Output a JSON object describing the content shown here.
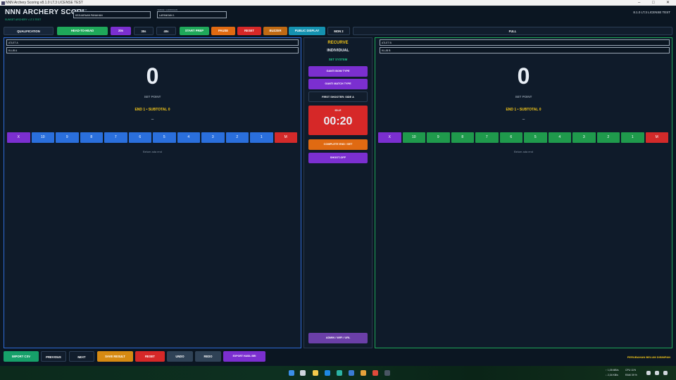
{
  "window": {
    "title": "NNN Archery Scoring v8.1.0 LT.3 LICENSE TEST",
    "minimize": "–",
    "maximize": "□",
    "close": "✕"
  },
  "header": {
    "brand": "NNN ARCHERY SCORI",
    "brand_sub": "SUNSET ARCHERY • LT.3 TEST",
    "event_label": "NAMA EVENT",
    "event_value": "KEJUARAAN PANAHAN",
    "venue_label": "VENUE / LAPANGAN",
    "venue_value": "LAPANGAN 1",
    "version": "8.1.0 LT.3 LICENSE TEST"
  },
  "toolbar": {
    "qualification": "QUALIFICATION",
    "head_to_head": "HEAD-TO-HEAD",
    "t20": "20s",
    "t30": "30s",
    "t40": "40s",
    "start_prep": "START PREP",
    "pause": "PAUSE",
    "reset": "RESET",
    "buzzer": "BUZZER",
    "public_display": "PUBLIC DISPLAY",
    "mon": "MON 2",
    "full": "FULL"
  },
  "left": {
    "athlete_placeholder": "ATLET A",
    "club_placeholder": "KLUB A",
    "score": "0",
    "set_point": "SET POINT",
    "end_subtotal": "END 1 • SUBTOTAL 0",
    "dash": "–",
    "empty": "Belum ada end",
    "keys": [
      "X",
      "10",
      "9",
      "8",
      "7",
      "6",
      "5",
      "4",
      "3",
      "2",
      "1",
      "M"
    ]
  },
  "right": {
    "athlete_placeholder": "ATLET B",
    "club_placeholder": "KLUB B",
    "score": "0",
    "set_point": "SET POINT",
    "end_subtotal": "END 1 • SUBTOTAL 0",
    "dash": "–",
    "empty": "Belum ada end",
    "keys": [
      "X",
      "10",
      "9",
      "8",
      "7",
      "6",
      "5",
      "4",
      "3",
      "2",
      "1",
      "M"
    ]
  },
  "center": {
    "bow": "RECURVE",
    "mode": "INDIVIDUAL",
    "system": "SET SYSTEM",
    "change_bow": "GANTI BOW TYPE",
    "change_match": "GANTI MATCH TYPE",
    "first_shooter": "FIRST SHOOTER: SIDE A",
    "timer_state": "IDLE",
    "timer": "00:20",
    "complete": "COMPLETE END / SET",
    "shootoff": "SHOOT-OFF",
    "admin": "ADMIN / WIFI / URL"
  },
  "bottom": {
    "import": "IMPORT CSV",
    "previous": "PREVIOUS",
    "next": "NEXT",
    "save": "SAVE RESULT",
    "reset": "RESET",
    "undo": "UNDO",
    "redo": "REDO",
    "export": "EXPORT HASIL BRI",
    "status": "PERUBAHAN BELUM DISIMPAN"
  },
  "taskbar": {
    "net_up": "↑ 1,05 MB/s",
    "net_down": "↓ 2,34 KB/s",
    "cpu": "CPU 11%",
    "ram": "RAM 39 %"
  },
  "colors": {
    "blue_key": "#2a6fdc",
    "green_key": "#1f9a4c",
    "x_key": "#7b2fd0",
    "m_key": "#d32a2a",
    "timer_red": "#d62828",
    "purple": "#7b2fd0",
    "orange": "#e06a12"
  }
}
